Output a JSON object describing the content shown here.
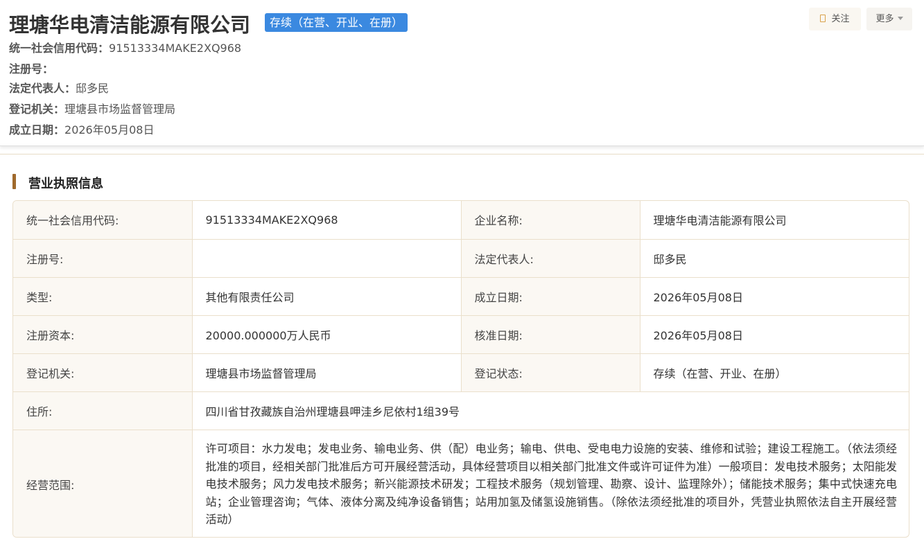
{
  "company": {
    "name": "理塘华电清洁能源有限公司",
    "status": "存续（在营、开业、在册）"
  },
  "actions": {
    "follow": "关注",
    "more": "更多"
  },
  "summary": {
    "credit_code_label": "统一社会信用代码：",
    "credit_code": "91513334MAKE2XQ968",
    "reg_no_label": "注册号：",
    "reg_no": "",
    "legal_rep_label": "法定代表人：",
    "legal_rep": "邸多民",
    "authority_label": "登记机关：",
    "authority": "理塘县市场监督管理局",
    "founded_label": "成立日期：",
    "founded": "2026年05月08日"
  },
  "section": {
    "title": "营业执照信息"
  },
  "license": {
    "credit_code_label": "统一社会信用代码:",
    "credit_code": "91513334MAKE2XQ968",
    "name_label": "企业名称:",
    "name": "理塘华电清洁能源有限公司",
    "reg_no_label": "注册号:",
    "reg_no": "",
    "legal_rep_label": "法定代表人:",
    "legal_rep": "邸多民",
    "type_label": "类型:",
    "type": "其他有限责任公司",
    "founded_label": "成立日期:",
    "founded": "2026年05月08日",
    "capital_label": "注册资本:",
    "capital": "20000.000000万人民币",
    "approved_label": "核准日期:",
    "approved": "2026年05月08日",
    "authority_label": "登记机关:",
    "authority": "理塘县市场监督管理局",
    "reg_status_label": "登记状态:",
    "reg_status": "存续（在营、开业、在册）",
    "address_label": "住所:",
    "address": "四川省甘孜藏族自治州理塘县呷洼乡尼依村1组39号",
    "scope_label": "经营范围:",
    "scope": "许可项目：水力发电；发电业务、输电业务、供（配）电业务；输电、供电、受电电力设施的安装、维修和试验；建设工程施工。（依法须经批准的项目，经相关部门批准后方可开展经营活动，具体经营项目以相关部门批准文件或许可证件为准）一般项目：发电技术服务；太阳能发电技术服务；风力发电技术服务；新兴能源技术研发；工程技术服务（规划管理、勘察、设计、监理除外）；储能技术服务；集中式快速充电站；企业管理咨询；气体、液体分离及纯净设备销售；站用加氢及储氢设施销售。（除依法须经批准的项目外，凭营业执照依法自主开展经营活动）"
  },
  "colors": {
    "badge": "#3b89e0",
    "accent": "#a06a2c",
    "label_bg": "#fbf8f3",
    "border": "#eadfcb"
  }
}
